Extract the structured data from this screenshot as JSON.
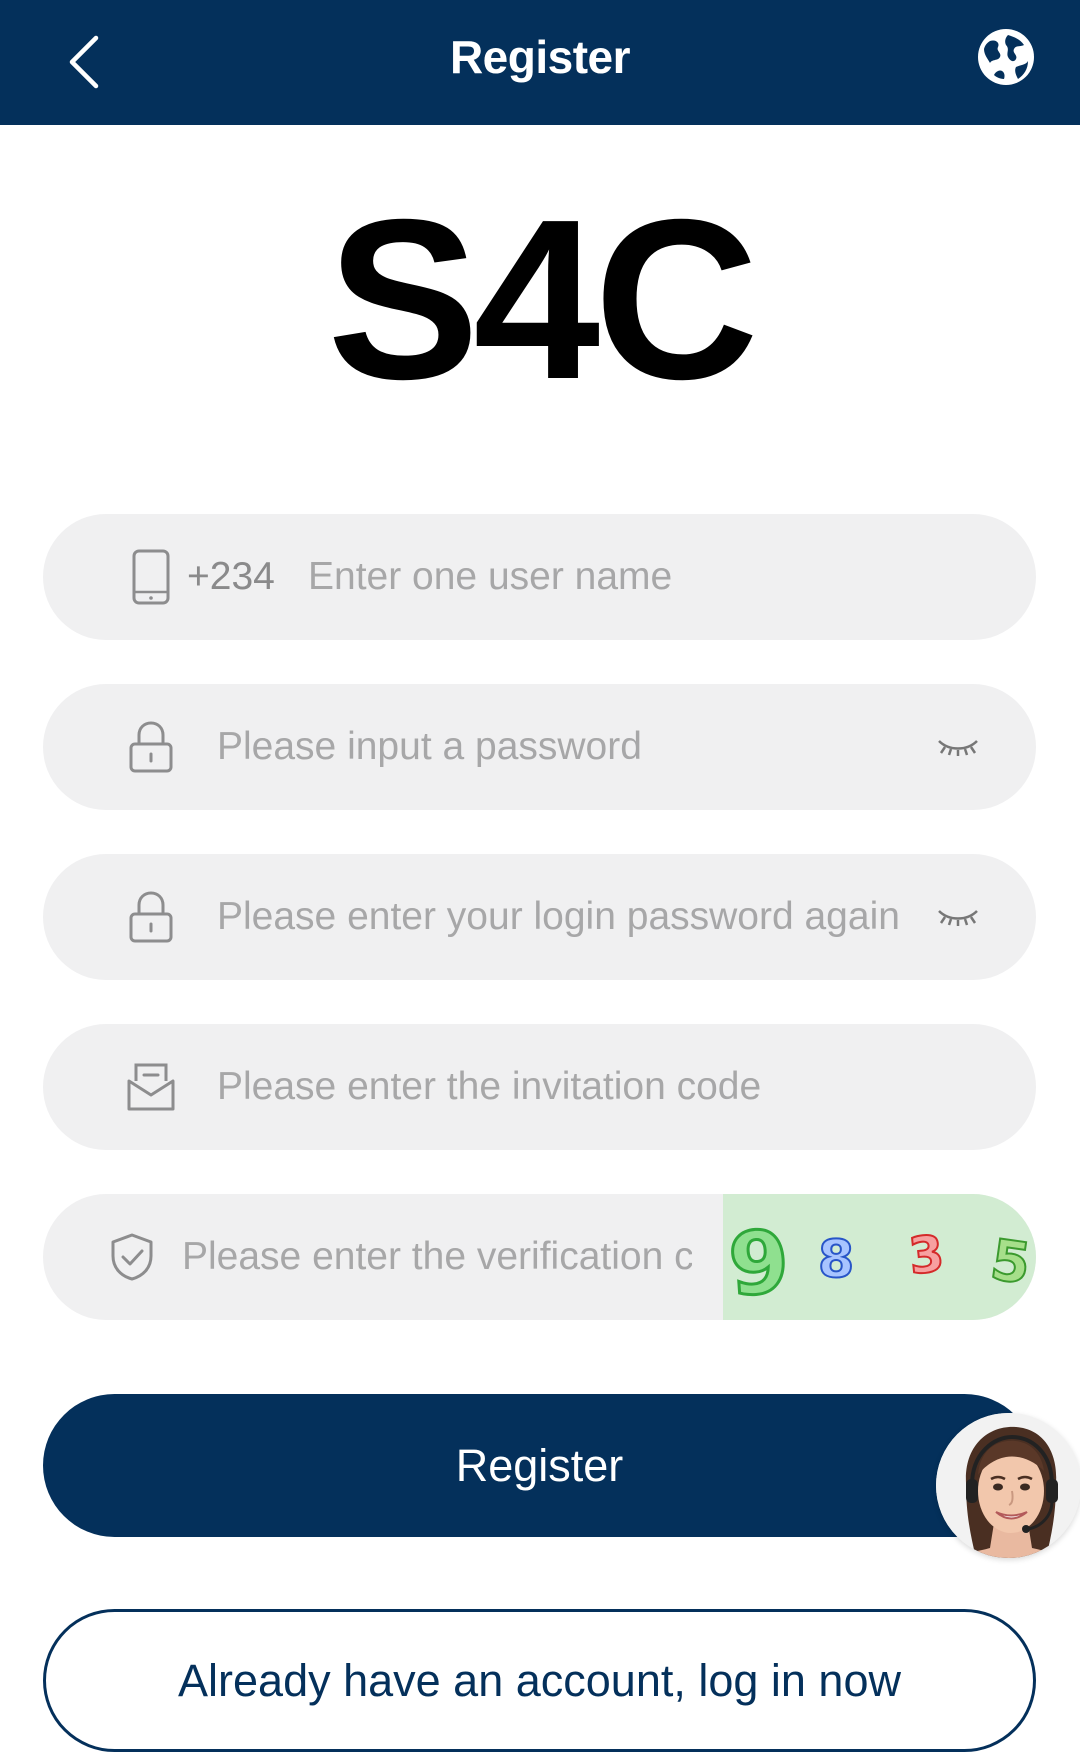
{
  "header": {
    "title": "Register",
    "back_icon": "chevron-left-icon",
    "language_icon": "globe-icon"
  },
  "logo": {
    "text": "S4C"
  },
  "form": {
    "username": {
      "icon": "phone-icon",
      "prefix": "+234",
      "placeholder": "Enter one user name",
      "value": ""
    },
    "password": {
      "icon": "lock-icon",
      "placeholder": "Please input a password",
      "value": ""
    },
    "confirm_password": {
      "icon": "lock-icon",
      "placeholder": "Please enter your login password again",
      "value": ""
    },
    "invitation": {
      "icon": "envelope-icon",
      "placeholder": "Please enter the invitation code",
      "value": ""
    },
    "verification": {
      "icon": "shield-check-icon",
      "placeholder": "Please enter the verification code",
      "value": "",
      "captcha_chars": [
        "9",
        "8",
        "3",
        "5"
      ]
    }
  },
  "buttons": {
    "register": "Register",
    "login": "Already have an account, log in now"
  },
  "support": {
    "icon": "customer-service-avatar"
  },
  "colors": {
    "primary": "#04305b",
    "field_bg": "#f0f0f1",
    "placeholder": "#a7a7a8",
    "captcha_bg": "#d2ecd2"
  }
}
